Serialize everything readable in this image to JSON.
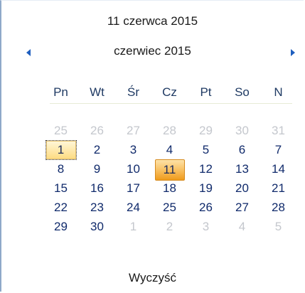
{
  "header": {
    "date_title": "11 czerwca 2015"
  },
  "nav": {
    "month_label": "czerwiec 2015",
    "prev_icon": "triangle-left-icon",
    "next_icon": "triangle-right-icon"
  },
  "weekdays": [
    "Pn",
    "Wt",
    "Śr",
    "Cz",
    "Pt",
    "So",
    "N"
  ],
  "days": [
    {
      "label": "25",
      "state": "other"
    },
    {
      "label": "26",
      "state": "other"
    },
    {
      "label": "27",
      "state": "other"
    },
    {
      "label": "28",
      "state": "other"
    },
    {
      "label": "29",
      "state": "other"
    },
    {
      "label": "30",
      "state": "other"
    },
    {
      "label": "31",
      "state": "other"
    },
    {
      "label": "1",
      "state": "today"
    },
    {
      "label": "2",
      "state": "current"
    },
    {
      "label": "3",
      "state": "current"
    },
    {
      "label": "4",
      "state": "current"
    },
    {
      "label": "5",
      "state": "current"
    },
    {
      "label": "6",
      "state": "current"
    },
    {
      "label": "7",
      "state": "current"
    },
    {
      "label": "8",
      "state": "current"
    },
    {
      "label": "9",
      "state": "current"
    },
    {
      "label": "10",
      "state": "current"
    },
    {
      "label": "11",
      "state": "selected"
    },
    {
      "label": "12",
      "state": "current"
    },
    {
      "label": "13",
      "state": "current"
    },
    {
      "label": "14",
      "state": "current"
    },
    {
      "label": "15",
      "state": "current"
    },
    {
      "label": "16",
      "state": "current"
    },
    {
      "label": "17",
      "state": "current"
    },
    {
      "label": "18",
      "state": "current"
    },
    {
      "label": "19",
      "state": "current"
    },
    {
      "label": "20",
      "state": "current"
    },
    {
      "label": "21",
      "state": "current"
    },
    {
      "label": "22",
      "state": "current"
    },
    {
      "label": "23",
      "state": "current"
    },
    {
      "label": "24",
      "state": "current"
    },
    {
      "label": "25",
      "state": "current"
    },
    {
      "label": "26",
      "state": "current"
    },
    {
      "label": "27",
      "state": "current"
    },
    {
      "label": "28",
      "state": "current"
    },
    {
      "label": "29",
      "state": "current"
    },
    {
      "label": "30",
      "state": "current"
    },
    {
      "label": "1",
      "state": "other"
    },
    {
      "label": "2",
      "state": "other"
    },
    {
      "label": "3",
      "state": "other"
    },
    {
      "label": "4",
      "state": "other"
    },
    {
      "label": "5",
      "state": "other"
    }
  ],
  "footer": {
    "clear_label": "Wyczyść"
  },
  "colors": {
    "accent": "#1f5fbf",
    "selected": "#f9c46a",
    "day_text": "#102a6b",
    "other_month_text": "#c4c7cd"
  }
}
